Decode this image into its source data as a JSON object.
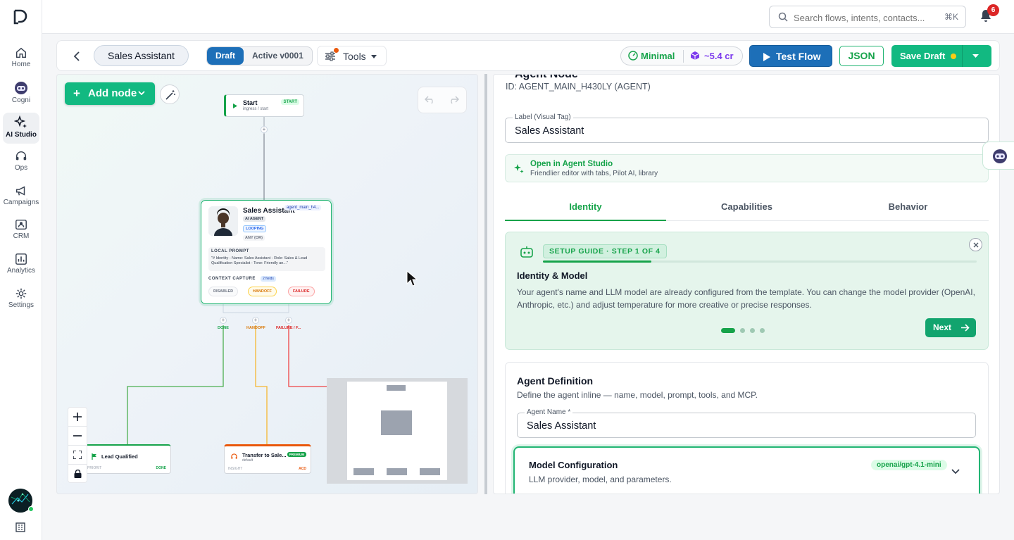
{
  "rail": {
    "items": [
      {
        "label": "Home",
        "icon": "home-icon"
      },
      {
        "label": "Cogni",
        "icon": "robot-icon"
      },
      {
        "label": "AI Studio",
        "icon": "sparkles-icon",
        "active": true
      },
      {
        "label": "Ops",
        "icon": "headset-icon"
      },
      {
        "label": "Campaigns",
        "icon": "megaphone-icon"
      },
      {
        "label": "CRM",
        "icon": "contact-card-icon"
      },
      {
        "label": "Analytics",
        "icon": "bar-chart-icon"
      },
      {
        "label": "Settings",
        "icon": "gear-icon"
      }
    ]
  },
  "header": {
    "search_placeholder": "Search flows, intents, contacts...",
    "search_shortcut": "⌘K",
    "notification_count": "6"
  },
  "toolbar": {
    "flow_name": "Sales Assistant",
    "version_draft": "Draft",
    "version_active": "Active v0001",
    "tools_label": "Tools",
    "cost_mode": "Minimal",
    "cost_credits": "~5.4 cr",
    "test_label": "Test Flow",
    "json_label": "JSON",
    "save_label": "Save Draft"
  },
  "canvas": {
    "add_node_label": "Add node",
    "start_node": {
      "title": "Start",
      "subtitle": "ingress / start",
      "badge": "START"
    },
    "agent_node": {
      "title": "Sales Assistant",
      "id": "agent_main_h4...",
      "chip_type": "AI AGENT",
      "chip_looping": "LOOPING",
      "chip_any": "ANY (OR)",
      "prompt_title": "LOCAL PROMPT",
      "prompt_text": "\"# Identity - Name: Sales Assistant - Role: Sales & Lead Qualification Specialist - Tone: Friendly an...\"",
      "context_title": "CONTEXT CAPTURE",
      "context_badge": "2 fields",
      "out_disabled": "DISABLED",
      "out_handoff": "HANDOFF",
      "out_failure": "FAILURE"
    },
    "ports": {
      "done": "DONE",
      "handoff": "HANDOFF",
      "failure": "FAILURE / F..."
    },
    "lead_node": {
      "title": "Lead Qualified",
      "meta": "PRIORIT",
      "tag": "DONE"
    },
    "transfer_node": {
      "title": "Transfer to Sale...",
      "subtitle": "default",
      "badge": "PREMIUM",
      "meta": "INSIGHT",
      "tag": "ACD"
    }
  },
  "panel": {
    "title_cut": "Agent Node",
    "id_line": "ID: AGENT_MAIN_H430LY (AGENT)",
    "label_legend": "Label (Visual Tag)",
    "label_value": "Sales Assistant",
    "studio_title": "Open in Agent Studio",
    "studio_sub": "Friendlier editor with tabs, Pilot AI, library",
    "tabs": [
      "Identity",
      "Capabilities",
      "Behavior"
    ],
    "guide": {
      "step": "SETUP GUIDE · STEP 1 OF 4",
      "title": "Identity & Model",
      "text": "Your agent's name and LLM model are already configured from the template. You can change the model provider (OpenAI, Anthropic, etc.) and adjust temperature for more creative or precise responses.",
      "next_label": "Next",
      "progress": 0.25
    },
    "definition": {
      "title": "Agent Definition",
      "subtitle": "Define the agent inline — name, model, prompt, tools, and MCP.",
      "name_legend": "Agent Name *",
      "name_value": "Sales Assistant"
    },
    "model": {
      "title": "Model Configuration",
      "subtitle": "LLM provider, model, and parameters.",
      "tag": "openai/gpt-4.1-mini"
    }
  },
  "colors": {
    "accent": "#12b981",
    "primary": "#1d6fb8",
    "handoff": "#f59e0b",
    "failure": "#ef4444"
  }
}
